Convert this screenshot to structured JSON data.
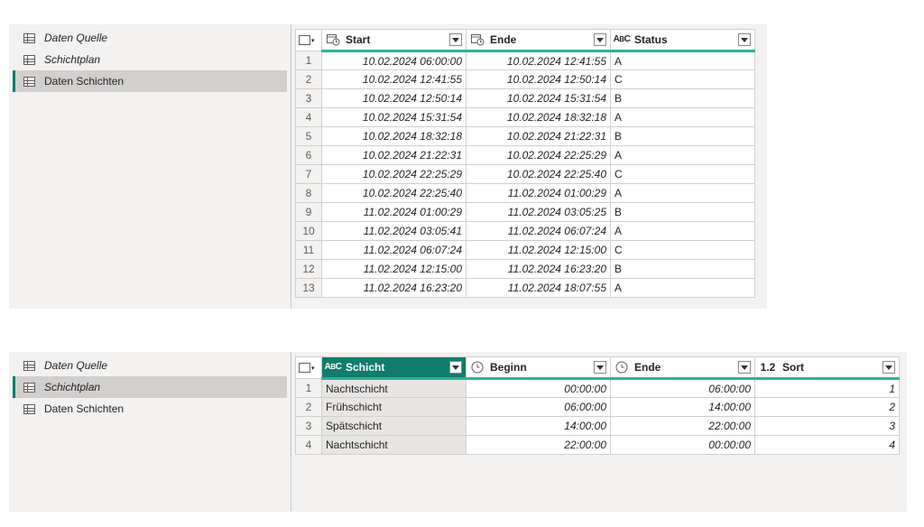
{
  "top": {
    "queries": [
      {
        "label": "Daten Quelle",
        "italic": true,
        "selected": false
      },
      {
        "label": "Schichtplan",
        "italic": true,
        "selected": false
      },
      {
        "label": "Daten Schichten",
        "italic": false,
        "selected": true
      }
    ],
    "columns": [
      {
        "name": "Start",
        "type_icon": "datetime-icon"
      },
      {
        "name": "Ende",
        "type_icon": "datetime-icon"
      },
      {
        "name": "Status",
        "type_icon": "text-type-icon"
      }
    ],
    "rows": [
      [
        "1",
        "10.02.2024 06:00:00",
        "10.02.2024 12:41:55",
        "A"
      ],
      [
        "2",
        "10.02.2024 12:41:55",
        "10.02.2024 12:50:14",
        "C"
      ],
      [
        "3",
        "10.02.2024 12:50:14",
        "10.02.2024 15:31:54",
        "B"
      ],
      [
        "4",
        "10.02.2024 15:31:54",
        "10.02.2024 18:32:18",
        "A"
      ],
      [
        "5",
        "10.02.2024 18:32:18",
        "10.02.2024 21:22:31",
        "B"
      ],
      [
        "6",
        "10.02.2024 21:22:31",
        "10.02.2024 22:25:29",
        "A"
      ],
      [
        "7",
        "10.02.2024 22:25:29",
        "10.02.2024 22:25:40",
        "C"
      ],
      [
        "8",
        "10.02.2024 22:25:40",
        "11.02.2024 01:00:29",
        "A"
      ],
      [
        "9",
        "11.02.2024 01:00:29",
        "11.02.2024 03:05:25",
        "B"
      ],
      [
        "10",
        "11.02.2024 03:05:41",
        "11.02.2024 06:07:24",
        "A"
      ],
      [
        "11",
        "11.02.2024 06:07:24",
        "11.02.2024 12:15:00",
        "C"
      ],
      [
        "12",
        "11.02.2024 12:15:00",
        "11.02.2024 16:23:20",
        "B"
      ],
      [
        "13",
        "11.02.2024 16:23:20",
        "11.02.2024 18:07:55",
        "A"
      ]
    ]
  },
  "bottom": {
    "queries": [
      {
        "label": "Daten Quelle",
        "italic": true,
        "selected": false
      },
      {
        "label": "Schichtplan",
        "italic": true,
        "selected": true
      },
      {
        "label": "Daten Schichten",
        "italic": false,
        "selected": false
      }
    ],
    "columns": [
      {
        "name": "Schicht",
        "type_icon": "text-type-icon",
        "selected": true
      },
      {
        "name": "Beginn",
        "type_icon": "time-icon"
      },
      {
        "name": "Ende",
        "type_icon": "time-icon"
      },
      {
        "name": "Sort",
        "type_icon": "decimal-type-icon",
        "type_label": "1.2"
      }
    ],
    "rows": [
      [
        "1",
        "Nachtschicht",
        "00:00:00",
        "06:00:00",
        "1"
      ],
      [
        "2",
        "Frühschicht",
        "06:00:00",
        "14:00:00",
        "2"
      ],
      [
        "3",
        "Spätschicht",
        "14:00:00",
        "22:00:00",
        "3"
      ],
      [
        "4",
        "Nachtschicht",
        "22:00:00",
        "00:00:00",
        "4"
      ]
    ]
  },
  "colors": {
    "accent": "#107c6c",
    "header_underline": "#2ab3a0",
    "panel_bg": "#f3f2f1",
    "selected_bg": "#d2d0ce"
  }
}
